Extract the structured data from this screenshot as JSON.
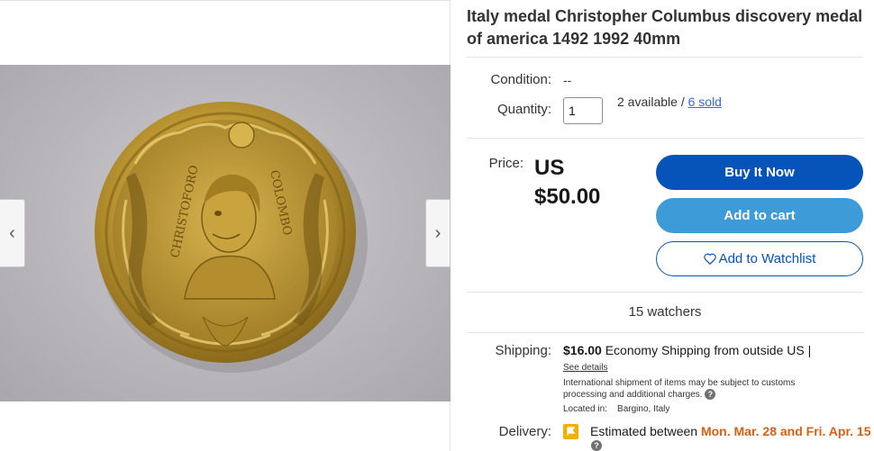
{
  "product": {
    "title": "Italy medal Christopher Columbus discovery medal of america 1492 1992 40mm"
  },
  "gallery": {
    "prev_icon": "chevron-left-icon",
    "next_icon": "chevron-right-icon",
    "prev_glyph": "‹",
    "next_glyph": "›",
    "medal_text_left": "CHRISTOFORO",
    "medal_text_right": "COLOMBO"
  },
  "condition": {
    "label": "Condition:",
    "value": "--"
  },
  "quantity": {
    "label": "Quantity:",
    "value": "1",
    "available": "2 available /",
    "sold": "6 sold"
  },
  "price": {
    "label": "Price:",
    "currency": "US",
    "amount": "$50.00"
  },
  "buttons": {
    "buy_now": "Buy It Now",
    "add_to_cart": "Add to cart",
    "add_to_watchlist": "Add to Watchlist"
  },
  "watchers": "15 watchers",
  "shipping": {
    "label": "Shipping:",
    "cost": "$16.00",
    "method": "Economy Shipping from outside US |",
    "see_details": "See details",
    "international_note_line1": "International shipment of items may be subject to customs",
    "international_note_line2": "processing and additional charges.",
    "located_in": "Located in:    Bargino, Italy"
  },
  "delivery": {
    "label": "Delivery:",
    "estimated": "Estimated between ",
    "dates": "Mon. Mar. 28 and Fri. Apr. 15"
  },
  "colors": {
    "buy_now": "#0654ba",
    "add_to_cart": "#3d9bd8",
    "link": "#3665f3",
    "delivery_dates": "#dd5f11"
  }
}
